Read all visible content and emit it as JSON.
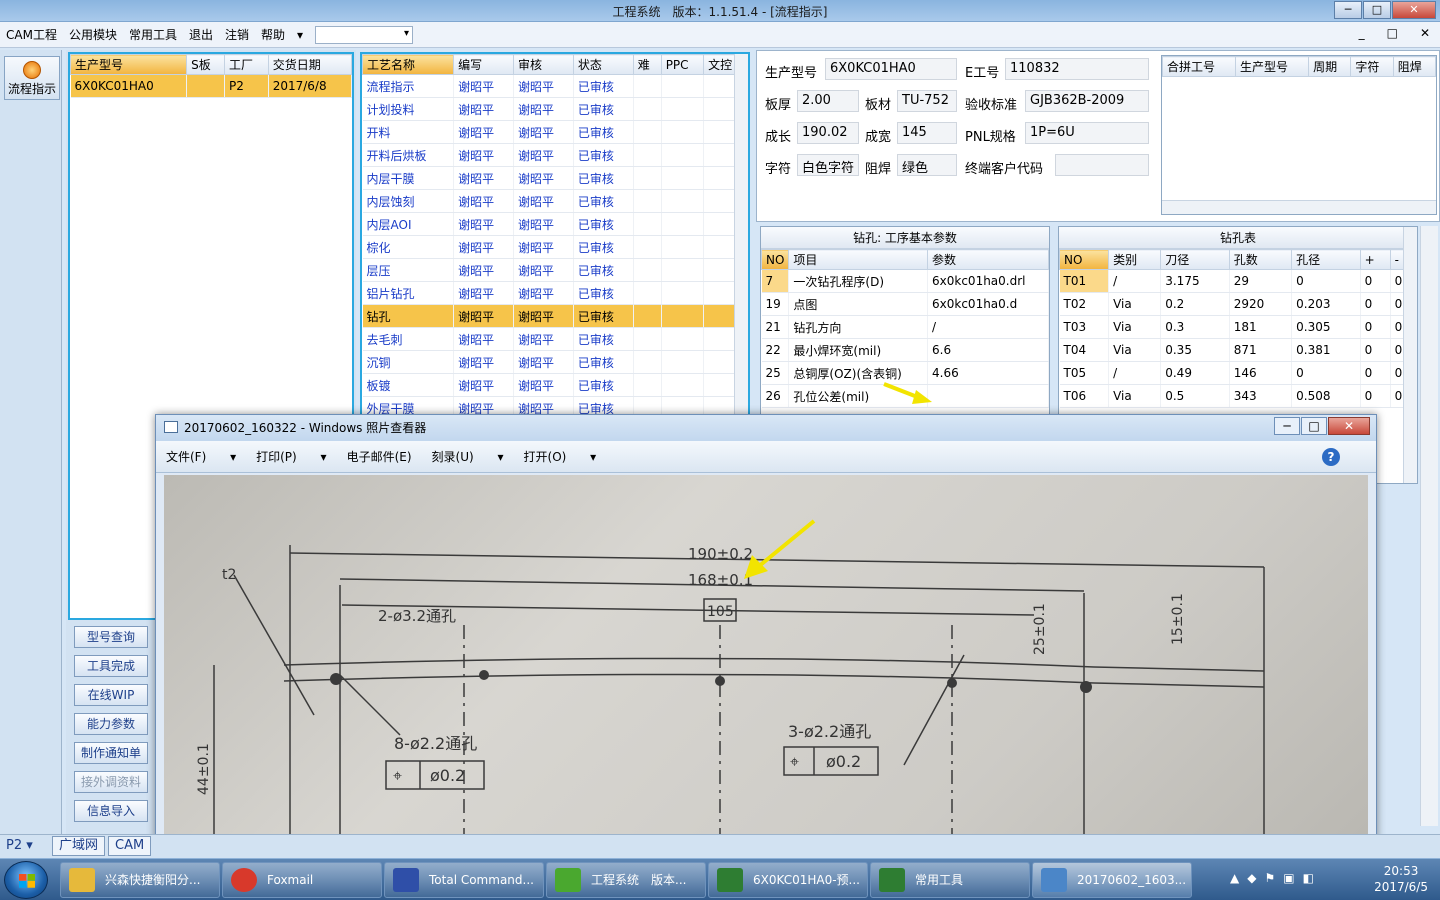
{
  "window": {
    "title": "工程系统　版本：1.1.51.4 - [流程指示]",
    "min": "─",
    "max": "□",
    "close": "✕"
  },
  "menu": {
    "items": [
      "CAM工程",
      "公用模块",
      "常用工具",
      "退出",
      "注销",
      "帮助"
    ],
    "mdi": [
      "_",
      "□",
      "✕"
    ]
  },
  "left": {
    "flow_button": "流程指示"
  },
  "order_table": {
    "headers": [
      "生产型号",
      "S板",
      "工厂",
      "交货日期"
    ],
    "rows": [
      [
        "6X0KC01HA0",
        "",
        "P2",
        "2017/6/8"
      ]
    ]
  },
  "side_buttons": [
    "型号查询",
    "工具完成",
    "在线WIP",
    "能力参数",
    "制作通知单",
    "接外调资料",
    "信息导入"
  ],
  "process_table": {
    "headers": [
      "工艺名称",
      "编写",
      "审核",
      "状态",
      "难",
      "PPC",
      "文控"
    ],
    "rows": [
      [
        "流程指示",
        "谢昭平",
        "谢昭平",
        "已审核"
      ],
      [
        "计划投料",
        "谢昭平",
        "谢昭平",
        "已审核"
      ],
      [
        "开料",
        "谢昭平",
        "谢昭平",
        "已审核"
      ],
      [
        "开料后烘板",
        "谢昭平",
        "谢昭平",
        "已审核"
      ],
      [
        "内层干膜",
        "谢昭平",
        "谢昭平",
        "已审核"
      ],
      [
        "内层蚀刻",
        "谢昭平",
        "谢昭平",
        "已审核"
      ],
      [
        "内层AOI",
        "谢昭平",
        "谢昭平",
        "已审核"
      ],
      [
        "棕化",
        "谢昭平",
        "谢昭平",
        "已审核"
      ],
      [
        "层压",
        "谢昭平",
        "谢昭平",
        "已审核"
      ],
      [
        "铝片钻孔",
        "谢昭平",
        "谢昭平",
        "已审核"
      ],
      [
        "钻孔",
        "谢昭平",
        "谢昭平",
        "已审核"
      ],
      [
        "去毛刺",
        "谢昭平",
        "谢昭平",
        "已审核"
      ],
      [
        "沉铜",
        "谢昭平",
        "谢昭平",
        "已审核"
      ],
      [
        "板镀",
        "谢昭平",
        "谢昭平",
        "已审核"
      ],
      [
        "外层干膜",
        "谢昭平",
        "谢昭平",
        "已审核"
      ]
    ],
    "selected_index": 10
  },
  "info": {
    "model_label": "生产型号",
    "model": "6X0KC01HA0",
    "eno_label": "E工号",
    "eno": "110832",
    "thick_label": "板厚",
    "thick": "2.00",
    "mat_label": "板材",
    "mat": "TU-752",
    "std_label": "验收标准",
    "std": "GJB362B-2009",
    "len_label": "成长",
    "len": "190.02",
    "wid_label": "成宽",
    "wid": "145",
    "pnl_label": "PNL规格",
    "pnl": "1P=6U",
    "char_label": "字符",
    "char": "白色字符",
    "mask_label": "阻焊",
    "mask": "绿色",
    "cust_label": "终端客户代码",
    "cust": ""
  },
  "merge_table": {
    "headers": [
      "合拼工号",
      "生产型号",
      "周期",
      "字符",
      "阻焊"
    ]
  },
  "drill_params": {
    "title": "钻孔: 工序基本参数",
    "headers": [
      "NO",
      "项目",
      "参数"
    ],
    "rows": [
      [
        "7",
        "一次钻孔程序(D)",
        "6x0kc01ha0.drl"
      ],
      [
        "19",
        "点图",
        "6x0kc01ha0.d"
      ],
      [
        "21",
        "钻孔方向",
        "/"
      ],
      [
        "22",
        "最小焊环宽(mil)",
        "6.6"
      ],
      [
        "25",
        "总铜厚(OZ)(含表铜)",
        "4.66"
      ],
      [
        "26",
        "孔位公差(mil)",
        ""
      ]
    ]
  },
  "drill_table": {
    "title": "钻孔表",
    "headers": [
      "NO",
      "类别",
      "刀径",
      "孔数",
      "孔径",
      "+",
      "-"
    ],
    "rows": [
      [
        "T01",
        "/",
        "3.175",
        "29",
        "0",
        "0",
        "0"
      ],
      [
        "T02",
        "Via",
        "0.2",
        "2920",
        "0.203",
        "0",
        "0"
      ],
      [
        "T03",
        "Via",
        "0.3",
        "181",
        "0.305",
        "0",
        "0"
      ],
      [
        "T04",
        "Via",
        "0.35",
        "871",
        "0.381",
        "0",
        "0"
      ],
      [
        "T05",
        "/",
        "0.49",
        "146",
        "0",
        "0",
        "0"
      ],
      [
        "T06",
        "Via",
        "0.5",
        "343",
        "0.508",
        "0",
        "0"
      ]
    ]
  },
  "viewer": {
    "title": "20170602_160322 - Windows 照片查看器",
    "menu": [
      "文件(F)",
      "打印(P)",
      "电子邮件(E)",
      "刻录(U)",
      "打开(O)"
    ],
    "help": "?",
    "drawing": {
      "dim_190": "190±0.2",
      "dim_168": "168±0.1",
      "dim_105": "105",
      "hole_2": "2-ø3.2通孔",
      "hole_8": "8-ø2.2通孔",
      "hole_3": "3-ø2.2通孔",
      "tol": "ø0.2",
      "side_44": "44±0.1",
      "side_25": "25±0.1",
      "side_15": "15±0.1",
      "t2": "t2"
    }
  },
  "bottom": {
    "factory": "P2",
    "tabs": [
      "广域网",
      "CAM"
    ]
  },
  "taskbar": {
    "items": [
      "兴森快捷衡阳分...",
      "Foxmail",
      "Total Command...",
      "工程系统　版本...",
      "6X0KC01HA0-预...",
      "常用工具",
      "20170602_1603..."
    ],
    "time": "20:53",
    "date": "2017/6/5"
  },
  "colors": {
    "accent": "#f6c44a",
    "link_blue": "#1a3cc8",
    "taskbar": "#2f5a8c"
  }
}
